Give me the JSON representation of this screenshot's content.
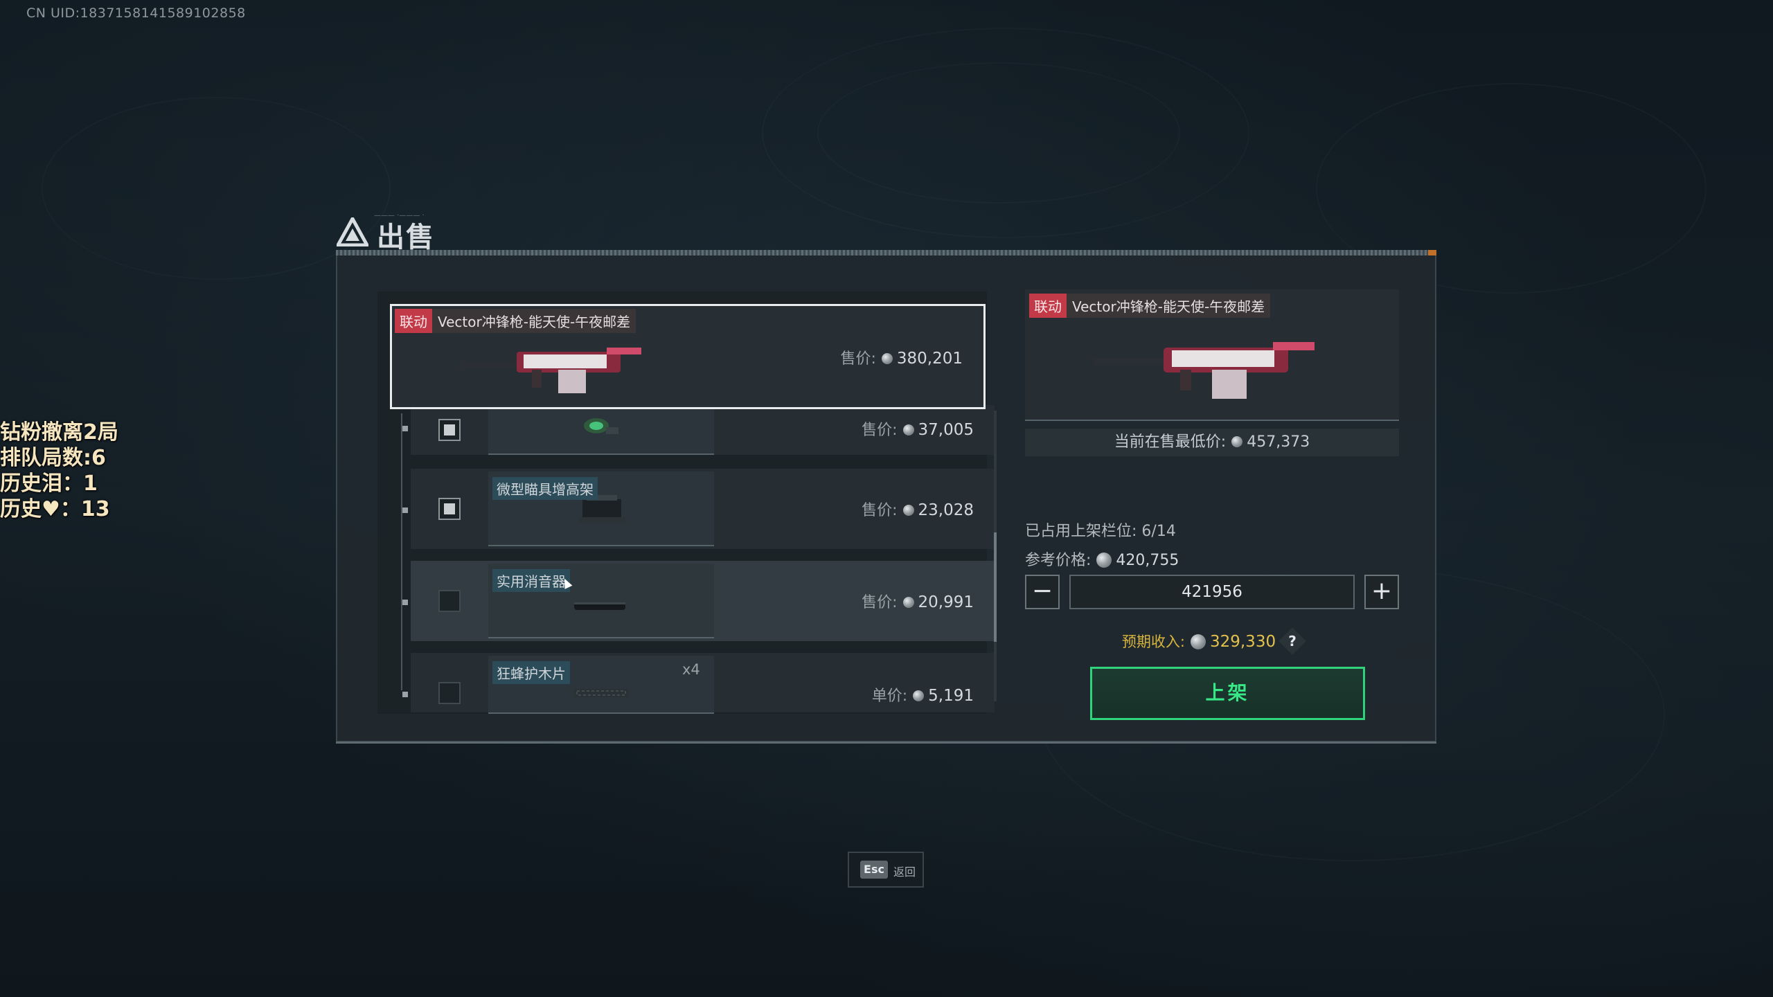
{
  "uid": "CN UID:1837158141589102858",
  "overlay": {
    "line1": "钻粉撤离2局",
    "line2": "排队局数:6",
    "line3": "历史泪：1",
    "line4": "历史♥：13"
  },
  "dialog": {
    "title": "出售",
    "title_deco": "——— ·——— ·"
  },
  "selected_item": {
    "linked_tag": "联动",
    "name": "Vector冲锋枪-能天使-午夜邮差",
    "price_label": "售价:",
    "price": "380,201"
  },
  "rows": [
    {
      "name": "",
      "price_label": "售价:",
      "price": "37,005",
      "checked": true
    },
    {
      "name": "微型瞄具增高架",
      "price_label": "售价:",
      "price": "23,028",
      "checked": true
    },
    {
      "name": "实用消音器",
      "price_label": "售价:",
      "price": "20,991",
      "checked": false
    },
    {
      "name": "狂蜂护木片",
      "quantity": "x4",
      "price_label": "单价:",
      "price": "5,191",
      "checked": false
    }
  ],
  "detail": {
    "linked_tag": "联动",
    "name": "Vector冲锋枪-能天使-午夜邮差",
    "lowest_price_label": "当前在售最低价:",
    "lowest_price": "457,373",
    "slots_label": "已占用上架栏位:",
    "slots_value": "6/14",
    "ref_price_label": "参考价格:",
    "ref_price": "420,755",
    "quantity_input": "421956",
    "minus": "−",
    "plus": "+",
    "income_label": "预期收入:",
    "income": "329,330",
    "help": "?",
    "list_button": "上架"
  },
  "esc": {
    "key": "Esc",
    "label": "返回"
  },
  "colors": {
    "accent_green": "#2fd37c",
    "income_gold": "#e3c14c",
    "linked_red": "#c23a47",
    "tag_blue": "#2c4c5a"
  },
  "icons": [
    "delta-logo-icon",
    "coin-icon",
    "minus-icon",
    "plus-icon",
    "help-icon",
    "esc-key-icon"
  ]
}
